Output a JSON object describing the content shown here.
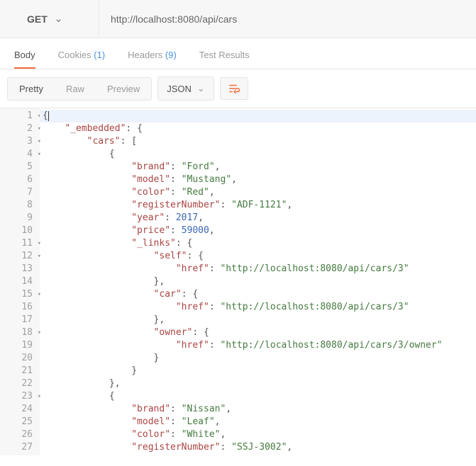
{
  "request": {
    "method": "GET",
    "url": "http://localhost:8080/api/cars"
  },
  "tabs": {
    "body": "Body",
    "cookies_label": "Cookies",
    "cookies_count": "(1)",
    "headers_label": "Headers",
    "headers_count": "(9)",
    "test_results": "Test Results"
  },
  "viewmodes": {
    "pretty": "Pretty",
    "raw": "Raw",
    "preview": "Preview"
  },
  "format": "JSON",
  "code_lines": [
    {
      "n": 1,
      "fold": true,
      "t": "{"
    },
    {
      "n": 2,
      "fold": true,
      "t": "    \"_embedded\": {"
    },
    {
      "n": 3,
      "fold": true,
      "t": "        \"cars\": ["
    },
    {
      "n": 4,
      "fold": true,
      "t": "            {"
    },
    {
      "n": 5,
      "fold": false,
      "t": "                \"brand\": \"Ford\","
    },
    {
      "n": 6,
      "fold": false,
      "t": "                \"model\": \"Mustang\","
    },
    {
      "n": 7,
      "fold": false,
      "t": "                \"color\": \"Red\","
    },
    {
      "n": 8,
      "fold": false,
      "t": "                \"registerNumber\": \"ADF-1121\","
    },
    {
      "n": 9,
      "fold": false,
      "t": "                \"year\": 2017,"
    },
    {
      "n": 10,
      "fold": false,
      "t": "                \"price\": 59000,"
    },
    {
      "n": 11,
      "fold": true,
      "t": "                \"_links\": {"
    },
    {
      "n": 12,
      "fold": true,
      "t": "                    \"self\": {"
    },
    {
      "n": 13,
      "fold": false,
      "t": "                        \"href\": \"http://localhost:8080/api/cars/3\""
    },
    {
      "n": 14,
      "fold": false,
      "t": "                    },"
    },
    {
      "n": 15,
      "fold": true,
      "t": "                    \"car\": {"
    },
    {
      "n": 16,
      "fold": false,
      "t": "                        \"href\": \"http://localhost:8080/api/cars/3\""
    },
    {
      "n": 17,
      "fold": false,
      "t": "                    },"
    },
    {
      "n": 18,
      "fold": true,
      "t": "                    \"owner\": {"
    },
    {
      "n": 19,
      "fold": false,
      "t": "                        \"href\": \"http://localhost:8080/api/cars/3/owner\""
    },
    {
      "n": 20,
      "fold": false,
      "t": "                    }"
    },
    {
      "n": 21,
      "fold": false,
      "t": "                }"
    },
    {
      "n": 22,
      "fold": false,
      "t": "            },"
    },
    {
      "n": 23,
      "fold": true,
      "t": "            {"
    },
    {
      "n": 24,
      "fold": false,
      "t": "                \"brand\": \"Nissan\","
    },
    {
      "n": 25,
      "fold": false,
      "t": "                \"model\": \"Leaf\","
    },
    {
      "n": 26,
      "fold": false,
      "t": "                \"color\": \"White\","
    },
    {
      "n": 27,
      "fold": false,
      "t": "                \"registerNumber\": \"SSJ-3002\","
    }
  ]
}
